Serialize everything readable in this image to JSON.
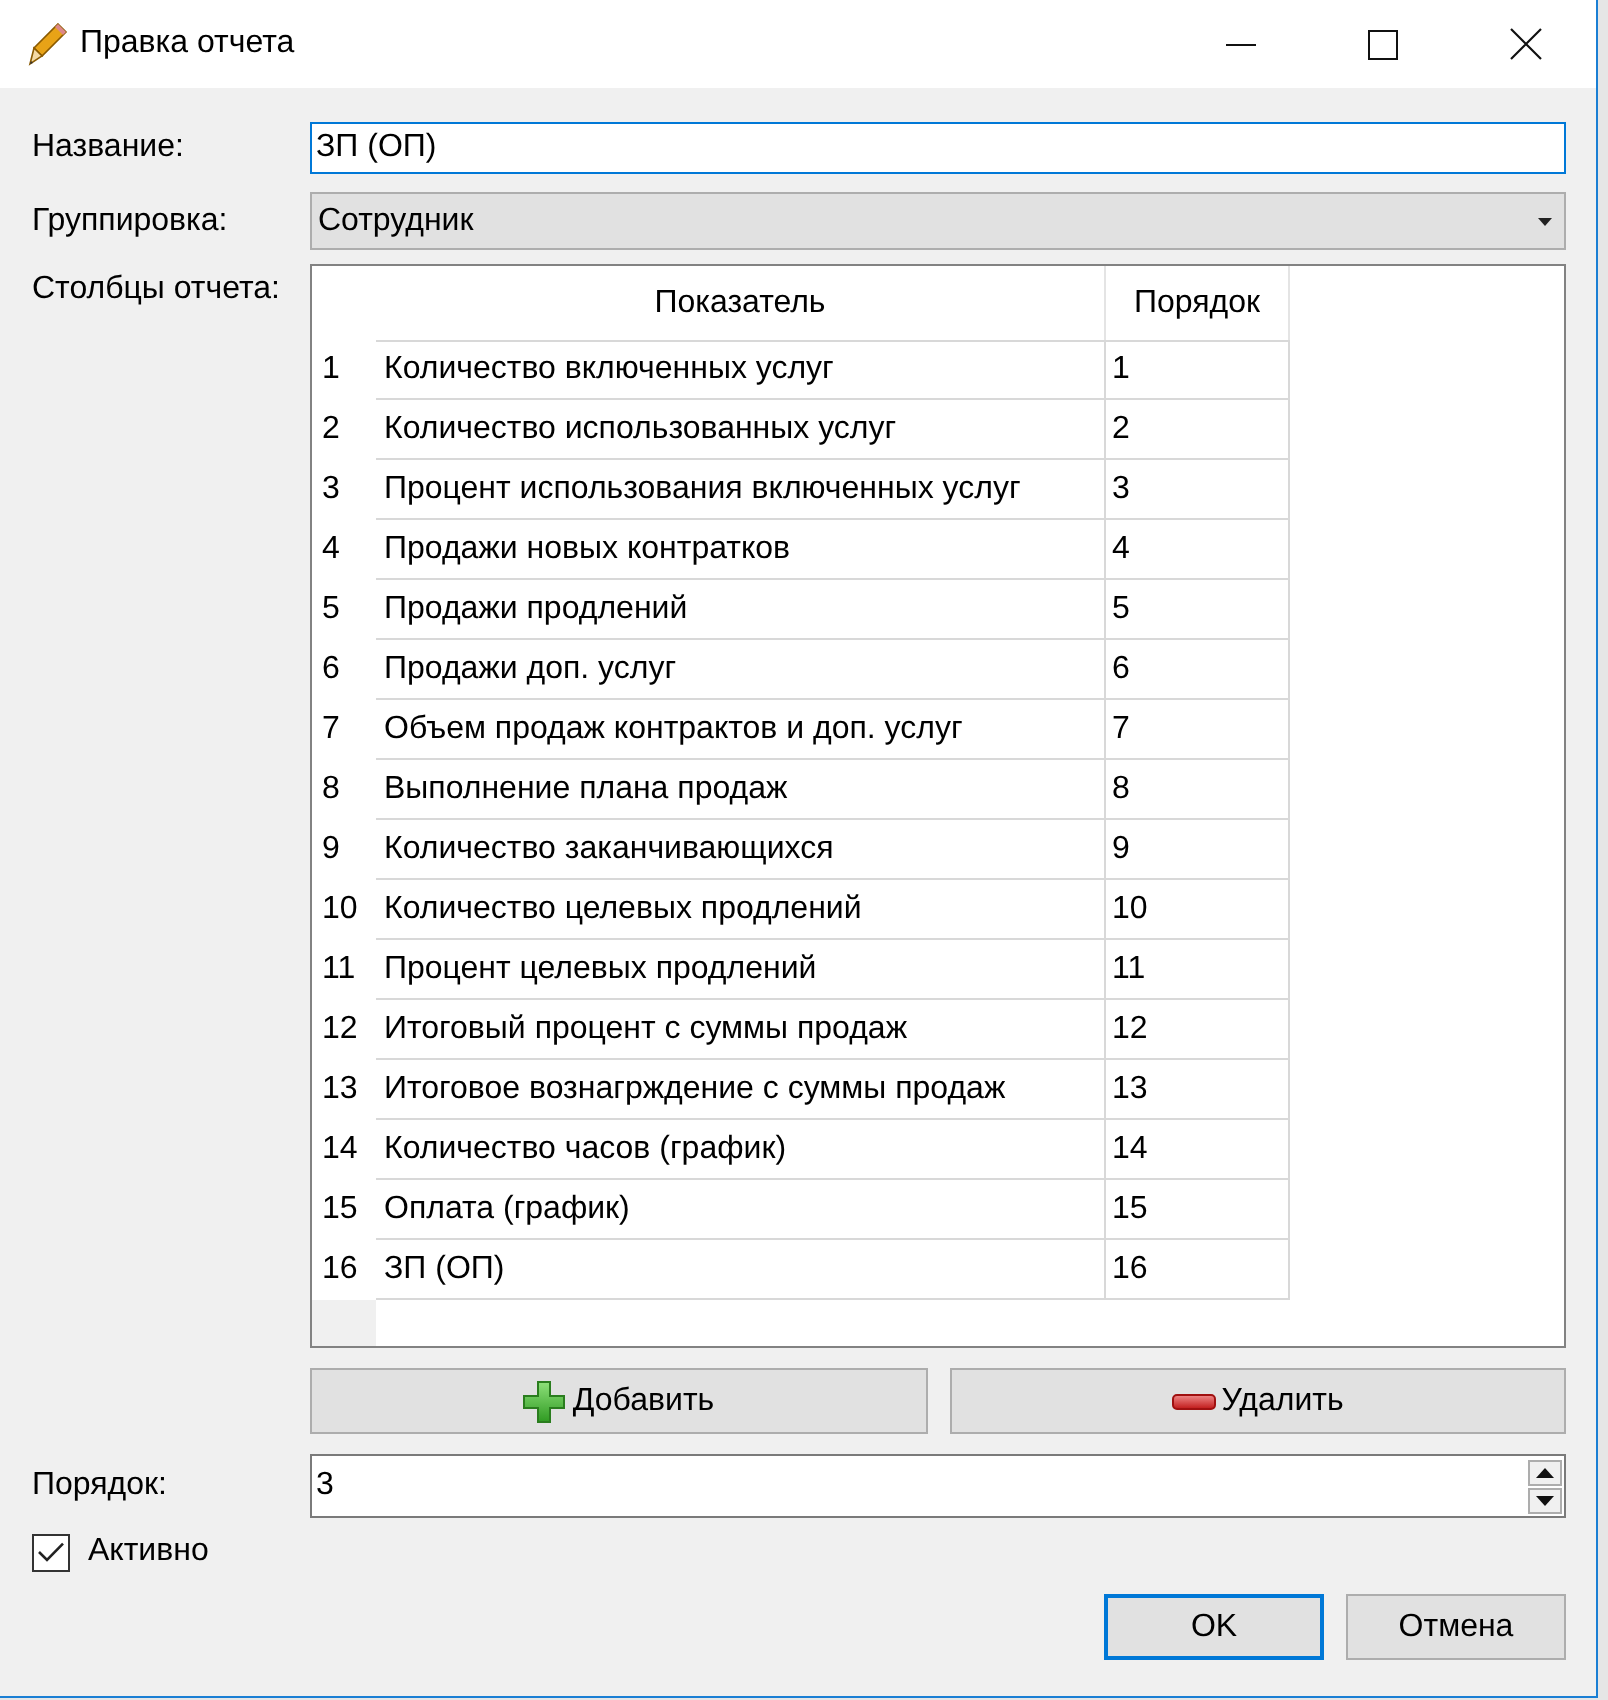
{
  "window": {
    "title": "Правка отчета"
  },
  "form": {
    "name": {
      "label": "Название:",
      "value": "ЗП (ОП)",
      "focused": true
    },
    "grouping": {
      "label": "Группировка:",
      "value": "Сотрудник"
    },
    "columns_label": "Столбцы отчета:"
  },
  "table": {
    "columns": [
      "Показатель",
      "Порядок"
    ],
    "rows": [
      {
        "number": "1",
        "indicator": "Количество включенных услуг",
        "order": "1"
      },
      {
        "number": "2",
        "indicator": "Количество использованных услуг",
        "order": "2"
      },
      {
        "number": "3",
        "indicator": "Процент использования включенных услуг",
        "order": "3"
      },
      {
        "number": "4",
        "indicator": "Продажи новых контратков",
        "order": "4"
      },
      {
        "number": "5",
        "indicator": "Продажи продлений",
        "order": "5"
      },
      {
        "number": "6",
        "indicator": "Продажи доп. услуг",
        "order": "6"
      },
      {
        "number": "7",
        "indicator": "Объем продаж контрактов и доп. услуг",
        "order": "7"
      },
      {
        "number": "8",
        "indicator": "Выполнение плана продаж",
        "order": "8"
      },
      {
        "number": "9",
        "indicator": "Количество заканчивающихся",
        "order": "9"
      },
      {
        "number": "10",
        "indicator": "Количество целевых продлений",
        "order": "10"
      },
      {
        "number": "11",
        "indicator": "Процент целевых продлений",
        "order": "11"
      },
      {
        "number": "12",
        "indicator": "Итоговый процент с суммы продаж",
        "order": "12"
      },
      {
        "number": "13",
        "indicator": "Итоговое вознагрждение с суммы продаж",
        "order": "13"
      },
      {
        "number": "14",
        "indicator": "Количество часов (график)",
        "order": "14"
      },
      {
        "number": "15",
        "indicator": "Оплата (график)",
        "order": "15"
      },
      {
        "number": "16",
        "indicator": "ЗП (ОП)",
        "order": "16"
      }
    ]
  },
  "table_buttons": [
    {
      "label": "Добавить",
      "kind": "add"
    },
    {
      "label": "Удалить",
      "kind": "remove"
    }
  ],
  "order": {
    "label": "Порядок:",
    "value": "3"
  },
  "active": {
    "label": "Активно",
    "checked": true
  },
  "dialog_buttons": [
    {
      "label": "OK",
      "default": true
    },
    {
      "label": "Отмена",
      "default": false
    }
  ]
}
